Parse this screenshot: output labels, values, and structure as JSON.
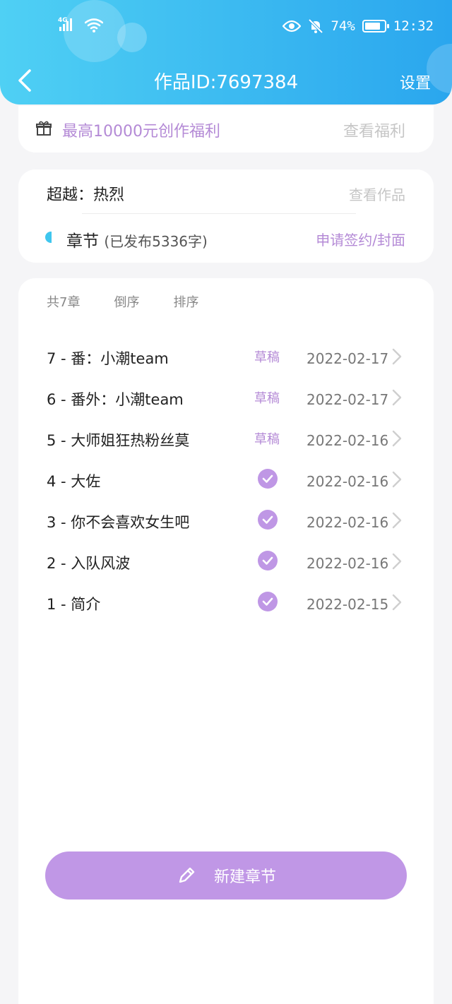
{
  "status_bar": {
    "network": "4G",
    "battery": "74%",
    "time": "12:32",
    "icons": [
      "signal-icon",
      "wifi-icon",
      "eye-icon",
      "bell-muted-icon",
      "battery-icon"
    ]
  },
  "header": {
    "title": "作品ID:7697384",
    "settings_label": "设置"
  },
  "promo": {
    "text": "最高10000元创作福利",
    "link": "查看福利"
  },
  "work": {
    "name": "超越：热烈",
    "view_link": "查看作品",
    "chapters_label": "章节",
    "chapters_sub": "(已发布5336字)",
    "apply_link": "申请签约/封面"
  },
  "toolbar": {
    "count": "共7章",
    "reverse": "倒序",
    "sort": "排序"
  },
  "chapters": [
    {
      "name": "7 - 番：小潮team",
      "status": "草稿",
      "date": "2022-02-17"
    },
    {
      "name": "6 - 番外：小潮team",
      "status": "草稿",
      "date": "2022-02-17"
    },
    {
      "name": "5 - 大师姐狂热粉丝莫",
      "status": "草稿",
      "date": "2022-02-16"
    },
    {
      "name": "4 - 大佐",
      "status": "published",
      "date": "2022-02-16"
    },
    {
      "name": "3 - 你不会喜欢女生吧",
      "status": "published",
      "date": "2022-02-16"
    },
    {
      "name": "2 - 入队风波",
      "status": "published",
      "date": "2022-02-16"
    },
    {
      "name": "1 - 简介",
      "status": "published",
      "date": "2022-02-15"
    }
  ],
  "new_chapter_button": "新建章节",
  "colors": {
    "header_gradient_start": "#4fd0f4",
    "header_gradient_end": "#2aa6ee",
    "accent_purple": "#b48ad6",
    "button_purple": "#c097e6",
    "chapter_dot": "#3fc6ee"
  }
}
